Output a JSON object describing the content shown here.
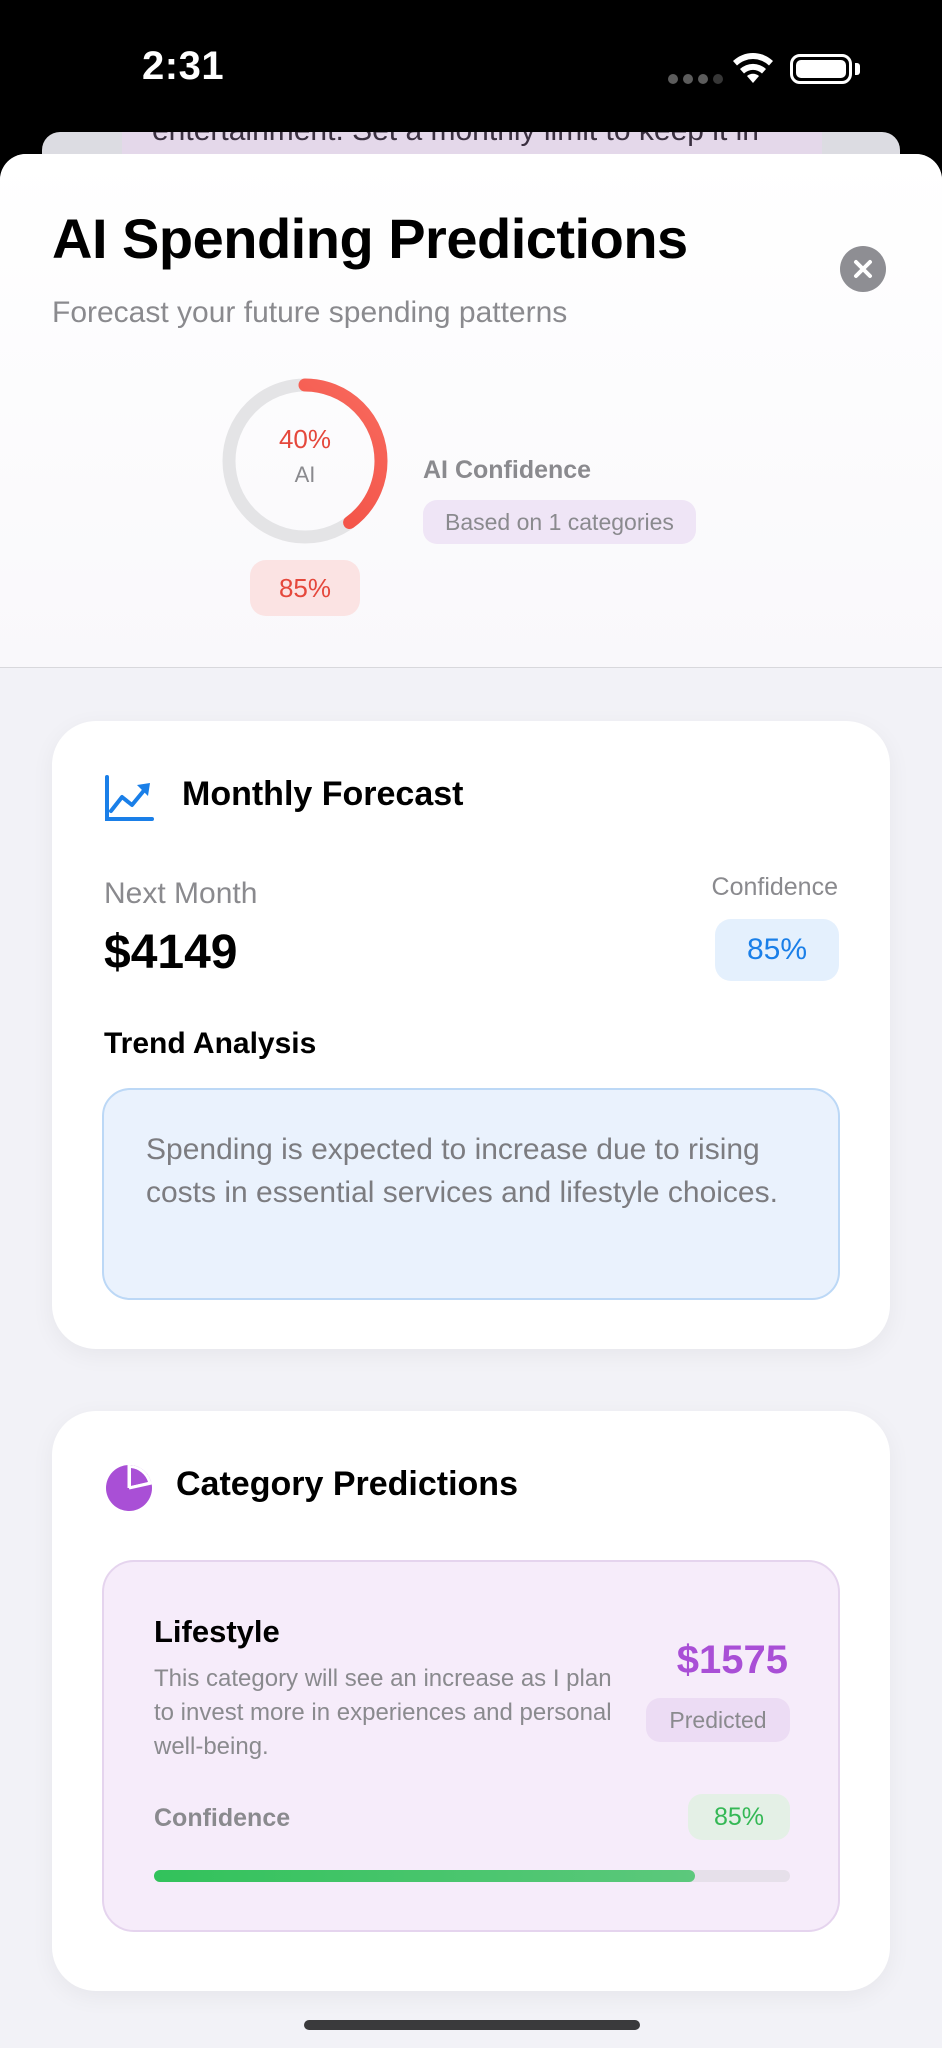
{
  "status_bar": {
    "time": "2:31"
  },
  "behind_sheet": {
    "text": "entertainment. Set a monthly limit to keep it in"
  },
  "header": {
    "title": "AI Spending Predictions",
    "subtitle": "Forecast your future spending patterns",
    "ring": {
      "percent_label": "40%",
      "center_label": "AI",
      "progress": 0.4,
      "color": "#f0453a"
    },
    "confidence_badge": "85%",
    "ai_confidence_label": "AI Confidence",
    "based_on": "Based on 1 categories"
  },
  "monthly_forecast": {
    "title": "Monthly Forecast",
    "icon": "chart-line-uptrend-icon",
    "next_month_label": "Next Month",
    "amount": "$4149",
    "confidence_label": "Confidence",
    "confidence_value": "85%",
    "trend_title": "Trend Analysis",
    "trend_text": "Spending is expected to increase due to rising costs in essential services and lifestyle choices."
  },
  "category_predictions": {
    "title": "Category Predictions",
    "icon": "pie-chart-icon",
    "items": [
      {
        "name": "Lifestyle",
        "description": "This category will see an increase as I plan to invest more in experiences and personal well-being.",
        "amount": "$1575",
        "predicted_label": "Predicted",
        "confidence_label": "Confidence",
        "confidence_value": "85%",
        "confidence_progress": 0.85
      }
    ]
  },
  "colors": {
    "accent_blue": "#1a7fe8",
    "accent_purple": "#a94fd6",
    "accent_red": "#e5483c",
    "accent_green": "#34b855"
  }
}
